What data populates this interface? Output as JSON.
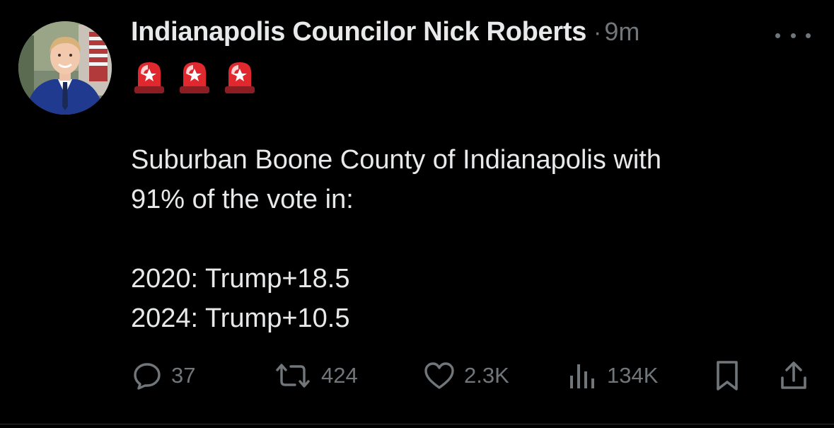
{
  "author": {
    "display_name": "Indianapolis Councilor Nick Roberts",
    "separator": "·",
    "time": "9m",
    "avatar_icon": "profile-photo"
  },
  "tweet": {
    "emoji": [
      "🚨",
      "🚨",
      "🚨"
    ],
    "line1": "Suburban Boone County of Indianapolis with",
    "line2": "91% of the vote in:",
    "line3": "2020: Trump+18.5",
    "line4": "2024: Trump+10.5"
  },
  "actions": {
    "replies": "37",
    "reposts": "424",
    "likes": "2.3K",
    "views": "134K",
    "icons": [
      "reply-icon",
      "repost-icon",
      "like-icon",
      "views-icon",
      "bookmark-icon",
      "share-icon"
    ]
  },
  "colors": {
    "background": "#000000",
    "text": "#e7e9ea",
    "secondary": "#71767b",
    "siren_red": "#e0282e"
  }
}
